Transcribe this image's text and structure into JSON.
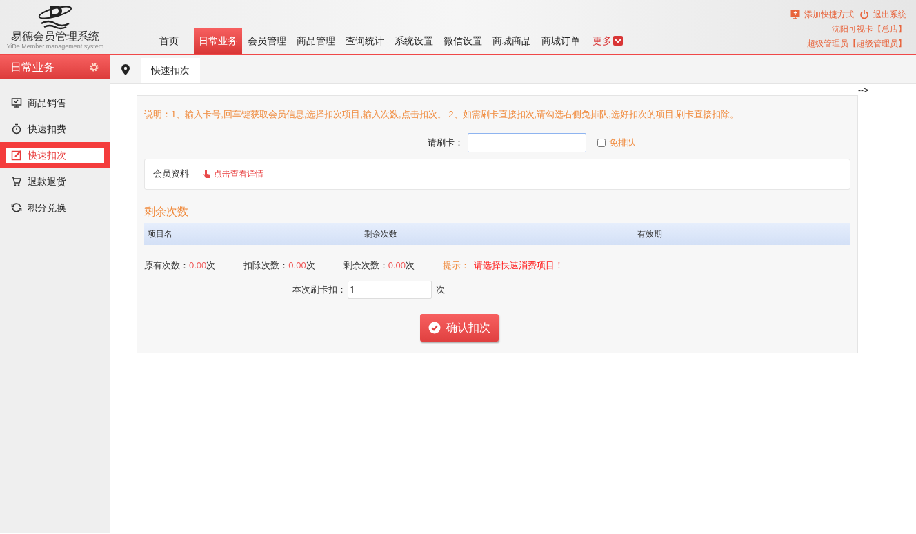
{
  "logo": {
    "title": "易德会员管理系统",
    "subtitle": "YiDe Member management system"
  },
  "nav": [
    {
      "label": "首页",
      "selected": false,
      "kind": "plain"
    },
    {
      "label": "日常业务",
      "selected": true,
      "kind": "plain"
    },
    {
      "label": "会员管理",
      "selected": false,
      "kind": "plain"
    },
    {
      "label": "商品管理",
      "selected": false,
      "kind": "plain"
    },
    {
      "label": "查询统计",
      "selected": false,
      "kind": "plain"
    },
    {
      "label": "系统设置",
      "selected": false,
      "kind": "plain"
    },
    {
      "label": "微信设置",
      "selected": false,
      "kind": "plain"
    },
    {
      "label": "商城商品",
      "selected": false,
      "kind": "plain"
    },
    {
      "label": "商城订单",
      "selected": false,
      "kind": "plain"
    },
    {
      "label": "更多",
      "selected": false,
      "kind": "more"
    }
  ],
  "top_links": [
    {
      "label": "添加快捷方式",
      "kind": "shortcut"
    },
    {
      "label": "退出系统",
      "kind": "logout"
    }
  ],
  "store": "沈阳可视卡【总店】",
  "user": "超级管理员【超级管理员】",
  "sidebar": {
    "title": "日常业务",
    "items": [
      {
        "label": "商品销售",
        "kind": "monitor",
        "selected": false
      },
      {
        "label": "快速扣费",
        "kind": "timer",
        "selected": false
      },
      {
        "label": "快速扣次",
        "kind": "edit",
        "selected": true
      },
      {
        "label": "退款退货",
        "kind": "cart",
        "selected": false
      },
      {
        "label": "积分兑换",
        "kind": "refresh",
        "selected": false
      }
    ]
  },
  "tabs": [
    {
      "label": "快速扣次",
      "selected": true
    }
  ],
  "stray_text": "-->",
  "instructions": "说明：1、输入卡号,回车键获取会员信息,选择扣次项目,输入次数,点击扣次。 2、如需刷卡直接扣次,请勾选右侧免排队,选好扣次的项目,刷卡直接扣除。",
  "card_field": {
    "label": "请刷卡："
  },
  "skip_queue": {
    "label": "免排队",
    "checked": false
  },
  "member_info": {
    "label": "会员资料",
    "link": "点击查看详情"
  },
  "remaining": {
    "title": "剩余次数",
    "columns": [
      "项目名",
      "剩余次数",
      "有效期"
    ]
  },
  "summary": [
    {
      "label": "原有次数：",
      "value": "0.00",
      "unit": "次"
    },
    {
      "label": "扣除次数：",
      "value": "0.00",
      "unit": "次"
    },
    {
      "label": "剩余次数：",
      "value": "0.00",
      "unit": "次"
    }
  ],
  "hint": {
    "label": "提示：",
    "message": "请选择快速消费项目！"
  },
  "deduct": {
    "label": "本次刷卡扣：",
    "value": "1",
    "unit": "次"
  },
  "confirm_button": "确认扣次"
}
